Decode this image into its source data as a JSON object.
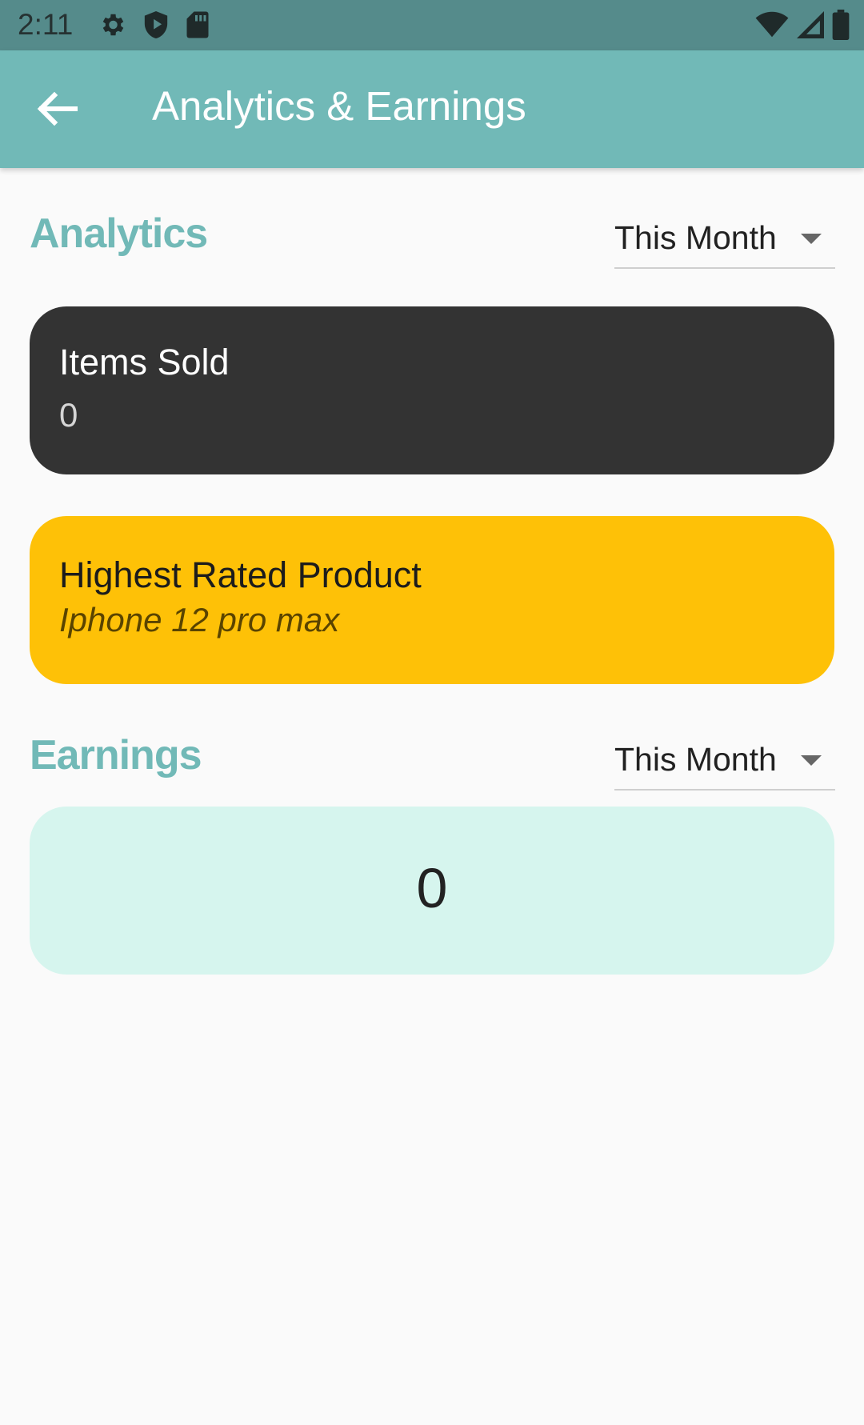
{
  "status_bar": {
    "time": "2:11",
    "left_icons": [
      "gear-icon",
      "shield-icon",
      "sd-card-icon"
    ],
    "right_icons": [
      "wifi-icon",
      "signal-icon",
      "battery-icon"
    ]
  },
  "app_bar": {
    "title": "Analytics & Earnings",
    "back_icon": "arrow-left-icon",
    "color": "#71b9b7"
  },
  "analytics": {
    "section_title": "Analytics",
    "period_dropdown": {
      "selected": "This Month"
    },
    "items_sold_card": {
      "label": "Items Sold",
      "value": "0",
      "color": "#333333"
    },
    "highest_rated_card": {
      "label": "Highest Rated Product",
      "value": "Iphone 12 pro max",
      "color": "#fec107"
    }
  },
  "earnings": {
    "section_title": "Earnings",
    "period_dropdown": {
      "selected": "This Month"
    },
    "value": "0",
    "card_color": "#d6f5ee"
  }
}
